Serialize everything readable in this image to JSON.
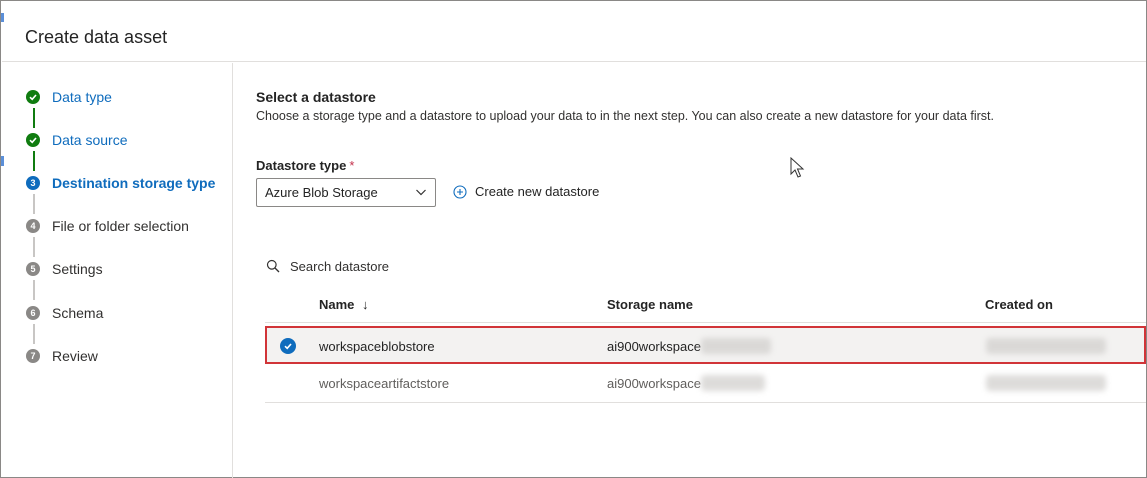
{
  "dialog": {
    "title": "Create data asset"
  },
  "steps": [
    {
      "number": "1",
      "label": "Data type",
      "status": "done"
    },
    {
      "number": "2",
      "label": "Data source",
      "status": "done"
    },
    {
      "number": "3",
      "label": "Destination storage type",
      "status": "current"
    },
    {
      "number": "4",
      "label": "File or folder selection",
      "status": "todo"
    },
    {
      "number": "5",
      "label": "Settings",
      "status": "todo"
    },
    {
      "number": "6",
      "label": "Schema",
      "status": "todo"
    },
    {
      "number": "7",
      "label": "Review",
      "status": "todo"
    }
  ],
  "section": {
    "title": "Select a datastore",
    "description": "Choose a storage type and a datastore to upload your data to in the next step. You can also create a new datastore for your data first."
  },
  "datastore_type": {
    "label": "Datastore type",
    "required_mark": "*",
    "selected": "Azure Blob Storage"
  },
  "create_new": {
    "label": "Create new datastore"
  },
  "search": {
    "placeholder": "Search datastore"
  },
  "table": {
    "columns": {
      "name": "Name",
      "sort_indicator": "↓",
      "storage": "Storage name",
      "created": "Created on"
    },
    "rows": [
      {
        "name": "workspaceblobstore",
        "storage": "ai900workspace",
        "selected": true
      },
      {
        "name": "workspaceartifactstore",
        "storage": "ai900workspace",
        "selected": false
      }
    ]
  },
  "colors": {
    "accent": "#0f6cbd",
    "success": "#107c10",
    "highlight_border": "#d13438",
    "required": "#c4314b"
  },
  "icons": [
    "check-circle-icon",
    "chevron-down-icon",
    "add-circle-icon",
    "search-icon",
    "checkmark-icon",
    "mouse-cursor-icon"
  ]
}
